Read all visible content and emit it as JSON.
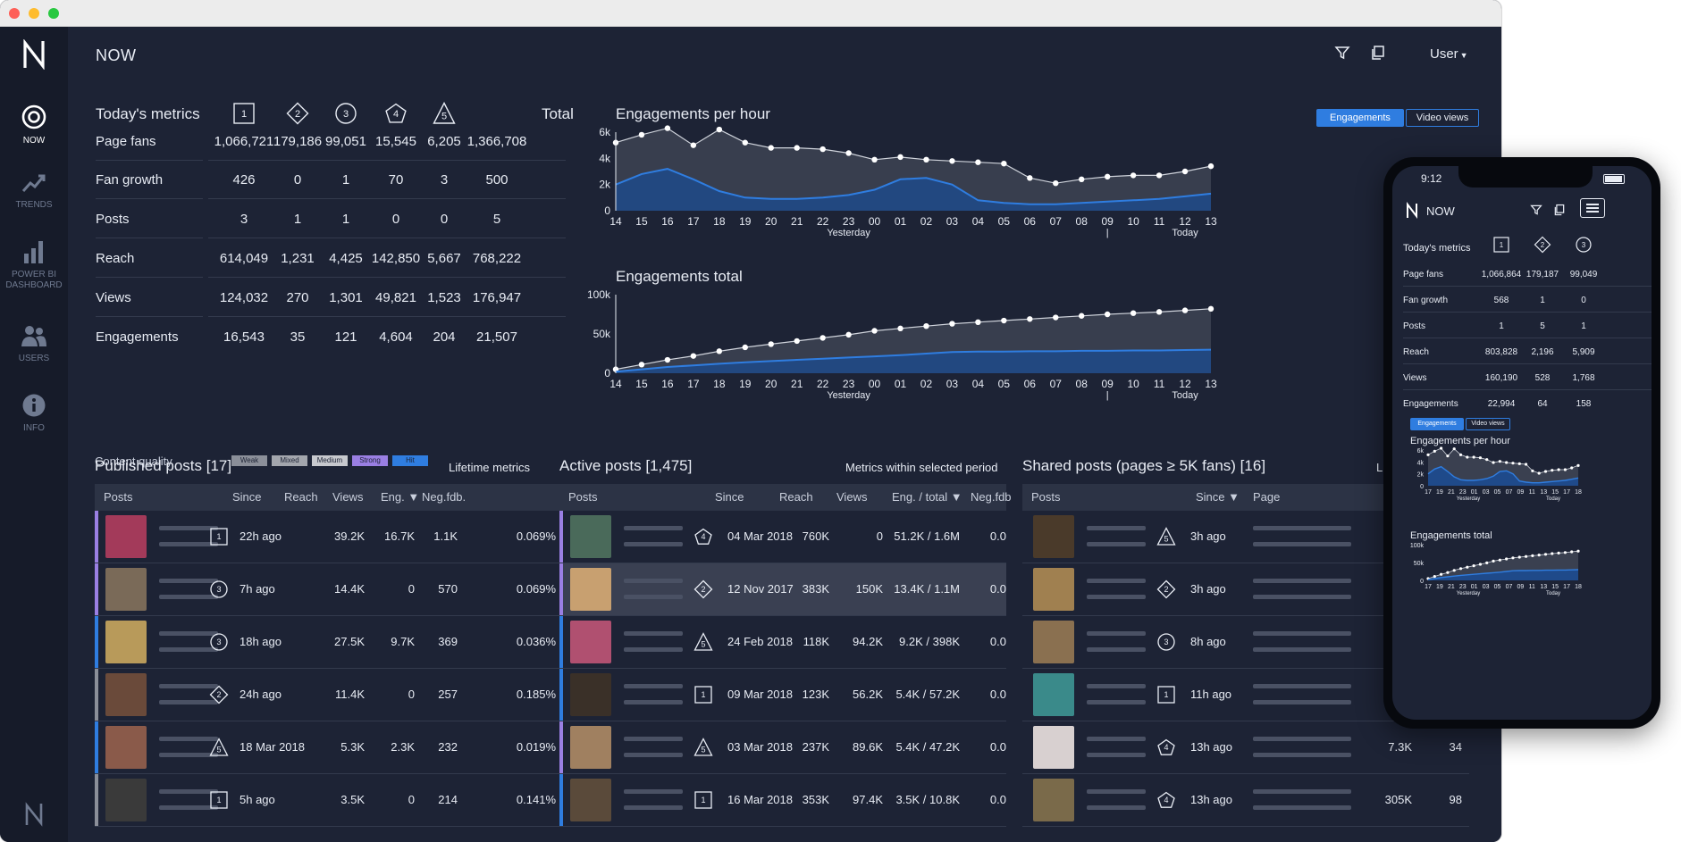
{
  "app": {
    "page_title": "NOW",
    "user_menu_label": "User",
    "filter_icon": "filter-icon",
    "copy_icon": "copy-icon",
    "accent_color": "#2f7de0"
  },
  "sidebar": {
    "items": [
      {
        "label": "NOW",
        "icon": "target-icon",
        "active": true
      },
      {
        "label": "TRENDS",
        "icon": "trend-icon",
        "active": false
      },
      {
        "label": "POWER BI DASHBOARD",
        "icon": "bar-chart-icon",
        "active": false
      },
      {
        "label": "USERS",
        "icon": "users-icon",
        "active": false
      },
      {
        "label": "INFO",
        "icon": "info-icon",
        "active": false
      }
    ]
  },
  "metrics": {
    "title": "Today's metrics",
    "level_badges": [
      "1",
      "2",
      "3",
      "4",
      "5"
    ],
    "total_label": "Total",
    "rows": [
      {
        "label": "Page fans",
        "values": [
          "1,066,721",
          "179,186",
          "99,051",
          "15,545",
          "6,205",
          "1,366,708"
        ]
      },
      {
        "label": "Fan growth",
        "values": [
          "426",
          "0",
          "1",
          "70",
          "3",
          "500"
        ]
      },
      {
        "label": "Posts",
        "values": [
          "3",
          "1",
          "1",
          "0",
          "0",
          "5"
        ]
      },
      {
        "label": "Reach",
        "values": [
          "614,049",
          "1,231",
          "4,425",
          "142,850",
          "5,667",
          "768,222"
        ]
      },
      {
        "label": "Views",
        "values": [
          "124,032",
          "270",
          "1,301",
          "49,821",
          "1,523",
          "176,947"
        ]
      },
      {
        "label": "Engagements",
        "values": [
          "16,543",
          "35",
          "121",
          "4,604",
          "204",
          "21,507"
        ]
      }
    ],
    "content_quality_label": "Content quality",
    "quality_levels": [
      {
        "label": "Weak",
        "color": "#8b8f99"
      },
      {
        "label": "Mixed",
        "color": "#a3a6ad"
      },
      {
        "label": "Medium",
        "color": "#c7c9ce"
      },
      {
        "label": "Strong",
        "color": "#9a7fe3"
      },
      {
        "label": "Hit",
        "color": "#2f7de0"
      }
    ]
  },
  "charts_panel": {
    "toggle_engagements": "Engagements",
    "toggle_video_views": "Video views",
    "yesterday_label": "Yesterday",
    "today_label": "Today"
  },
  "chart_data": [
    {
      "type": "area",
      "title": "Engagements per hour",
      "categories": [
        "14",
        "15",
        "16",
        "17",
        "18",
        "19",
        "20",
        "21",
        "22",
        "23",
        "00",
        "01",
        "02",
        "03",
        "04",
        "05",
        "06",
        "07",
        "08",
        "09",
        "10",
        "11",
        "12",
        "13"
      ],
      "yticks": [
        "0",
        "2k",
        "4k",
        "6k"
      ],
      "ylim": [
        0,
        6000
      ],
      "series": [
        {
          "values": [
            5200,
            5800,
            6300,
            5000,
            6200,
            5200,
            4800,
            4800,
            4700,
            4400,
            3900,
            4100,
            3900,
            3800,
            3700,
            3600,
            2500,
            2100,
            2400,
            2600,
            2700,
            2700,
            3000,
            3400
          ],
          "color": "#d0d4dc"
        },
        {
          "values": [
            2000,
            2800,
            3200,
            2400,
            1500,
            1000,
            900,
            900,
            1000,
            1200,
            1600,
            2400,
            2500,
            2000,
            800,
            600,
            500,
            500,
            600,
            700,
            800,
            900,
            1100,
            1300
          ],
          "color": "#2f7de0"
        }
      ]
    },
    {
      "type": "area",
      "title": "Engagements total",
      "categories": [
        "14",
        "15",
        "16",
        "17",
        "18",
        "19",
        "20",
        "21",
        "22",
        "23",
        "00",
        "01",
        "02",
        "03",
        "04",
        "05",
        "06",
        "07",
        "08",
        "09",
        "10",
        "11",
        "12",
        "13"
      ],
      "yticks": [
        "0",
        "50k",
        "100k"
      ],
      "ylim": [
        0,
        100000
      ],
      "series": [
        {
          "values": [
            5000,
            11000,
            17000,
            22000,
            28000,
            33000,
            37000,
            41000,
            45000,
            49000,
            54000,
            57000,
            60000,
            63000,
            65000,
            67000,
            69000,
            71000,
            73000,
            75000,
            76500,
            78000,
            80000,
            82000
          ],
          "color": "#d0d4dc"
        },
        {
          "values": [
            2000,
            5000,
            8000,
            10000,
            12000,
            14000,
            15500,
            17000,
            18500,
            20000,
            21500,
            23000,
            25000,
            27000,
            27500,
            27500,
            28000,
            28000,
            28500,
            28500,
            29000,
            29000,
            29500,
            30000
          ],
          "color": "#2f7de0"
        }
      ]
    }
  ],
  "published_posts": {
    "title": "Published posts [17]",
    "subtitle": "Lifetime metrics",
    "columns": [
      "Posts",
      "Since",
      "Reach",
      "Views",
      "Eng. ▼",
      "Neg.fdb."
    ],
    "rows": [
      {
        "level": "1",
        "since": "22h ago",
        "reach": "39.2K",
        "views": "16.7K",
        "eng": "1.1K",
        "neg": "0.069%",
        "bar": "#9a7fe3",
        "thumb": "#a33a5a"
      },
      {
        "level": "3",
        "since": "7h ago",
        "reach": "14.4K",
        "views": "0",
        "eng": "570",
        "neg": "0.069%",
        "bar": "#9a7fe3",
        "thumb": "#7a6a58"
      },
      {
        "level": "3",
        "since": "18h ago",
        "reach": "27.5K",
        "views": "9.7K",
        "eng": "369",
        "neg": "0.036%",
        "bar": "#2f7de0",
        "thumb": "#b89a5a"
      },
      {
        "level": "2",
        "since": "24h ago",
        "reach": "11.4K",
        "views": "0",
        "eng": "257",
        "neg": "0.185%",
        "bar": "#8b8f99",
        "thumb": "#6a4a3a"
      },
      {
        "level": "5",
        "since": "18 Mar 2018",
        "reach": "5.3K",
        "views": "2.3K",
        "eng": "232",
        "neg": "0.019%",
        "bar": "#2f7de0",
        "thumb": "#8a5a4a"
      },
      {
        "level": "1",
        "since": "5h ago",
        "reach": "3.5K",
        "views": "0",
        "eng": "214",
        "neg": "0.141%",
        "bar": "#8b8f99",
        "thumb": "#3a3a3a"
      }
    ]
  },
  "active_posts": {
    "title": "Active posts [1,475]",
    "subtitle": "Metrics within selected period",
    "columns": [
      "Posts",
      "Since",
      "Reach",
      "Views",
      "Eng. / total ▼",
      "Neg.fdb"
    ],
    "rows": [
      {
        "level": "4",
        "since": "04 Mar 2018",
        "reach": "760K",
        "views": "0",
        "eng": "51.2K / 1.6M",
        "neg": "0.0",
        "bar": "#9a7fe3",
        "thumb": "#4a6a5a"
      },
      {
        "level": "2",
        "since": "12 Nov 2017",
        "reach": "383K",
        "views": "150K",
        "eng": "13.4K / 1.1M",
        "neg": "0.0",
        "bar": "#9a7fe3",
        "thumb": "#c8a070",
        "selected": true
      },
      {
        "level": "5",
        "since": "24 Feb 2018",
        "reach": "118K",
        "views": "94.2K",
        "eng": "9.2K / 398K",
        "neg": "0.0",
        "bar": "#2f7de0",
        "thumb": "#b05070"
      },
      {
        "level": "1",
        "since": "09 Mar 2018",
        "reach": "123K",
        "views": "56.2K",
        "eng": "5.4K / 57.2K",
        "neg": "0.0",
        "bar": "#2f7de0",
        "thumb": "#3a3028"
      },
      {
        "level": "5",
        "since": "03 Mar 2018",
        "reach": "237K",
        "views": "89.6K",
        "eng": "5.4K / 47.2K",
        "neg": "0.0",
        "bar": "#9a7fe3",
        "thumb": "#a08060"
      },
      {
        "level": "1",
        "since": "16 Mar 2018",
        "reach": "353K",
        "views": "97.4K",
        "eng": "3.5K / 10.8K",
        "neg": "0.0",
        "bar": "#2f7de0",
        "thumb": "#5a4a3a"
      }
    ]
  },
  "shared_posts": {
    "title": "Shared posts (pages ≥ 5K fans) [16]",
    "subtitle_partial": "Li",
    "columns": [
      "Posts",
      "Since ▼",
      "Page"
    ],
    "rows": [
      {
        "level": "5",
        "since": "3h ago",
        "reach": "",
        "eng": "",
        "thumb": "#4a3a2a"
      },
      {
        "level": "2",
        "since": "3h ago",
        "reach": "",
        "eng": "",
        "thumb": "#a08050"
      },
      {
        "level": "3",
        "since": "8h ago",
        "reach": "",
        "eng": "",
        "thumb": "#8a7050"
      },
      {
        "level": "1",
        "since": "11h ago",
        "reach": "",
        "eng": "",
        "thumb": "#3a8a8a"
      },
      {
        "level": "4",
        "since": "13h ago",
        "reach": "7.3K",
        "eng": "34",
        "thumb": "#d8d0d0"
      },
      {
        "level": "4",
        "since": "13h ago",
        "reach": "305K",
        "eng": "98",
        "thumb": "#7a6a4a"
      }
    ]
  },
  "phone": {
    "time": "9:12",
    "page_title": "NOW",
    "metrics_title": "Today's metrics",
    "level_badges": [
      "1",
      "2",
      "3"
    ],
    "rows": [
      {
        "label": "Page fans",
        "values": [
          "1,066,864",
          "179,187",
          "99,049"
        ]
      },
      {
        "label": "Fan growth",
        "values": [
          "568",
          "1",
          "0"
        ]
      },
      {
        "label": "Posts",
        "values": [
          "1",
          "5",
          "1"
        ]
      },
      {
        "label": "Reach",
        "values": [
          "803,828",
          "2,196",
          "5,909"
        ]
      },
      {
        "label": "Views",
        "values": [
          "160,190",
          "528",
          "1,768"
        ]
      },
      {
        "label": "Engagements",
        "values": [
          "22,994",
          "64",
          "158"
        ]
      }
    ],
    "toggle_engagements": "Engagements",
    "toggle_video_views": "Video views",
    "chart1_title": "Engagements per hour",
    "chart2_title": "Engagements total",
    "chart1_yticks": [
      "0",
      "2k",
      "4k",
      "6k"
    ],
    "chart2_yticks": [
      "0",
      "50k",
      "100k"
    ],
    "xticks": [
      "17",
      "19",
      "21",
      "23",
      "01",
      "03",
      "05",
      "07",
      "09",
      "11",
      "13",
      "15",
      "17",
      "18"
    ],
    "yesterday_label": "Yesterday",
    "today_label": "Today"
  }
}
